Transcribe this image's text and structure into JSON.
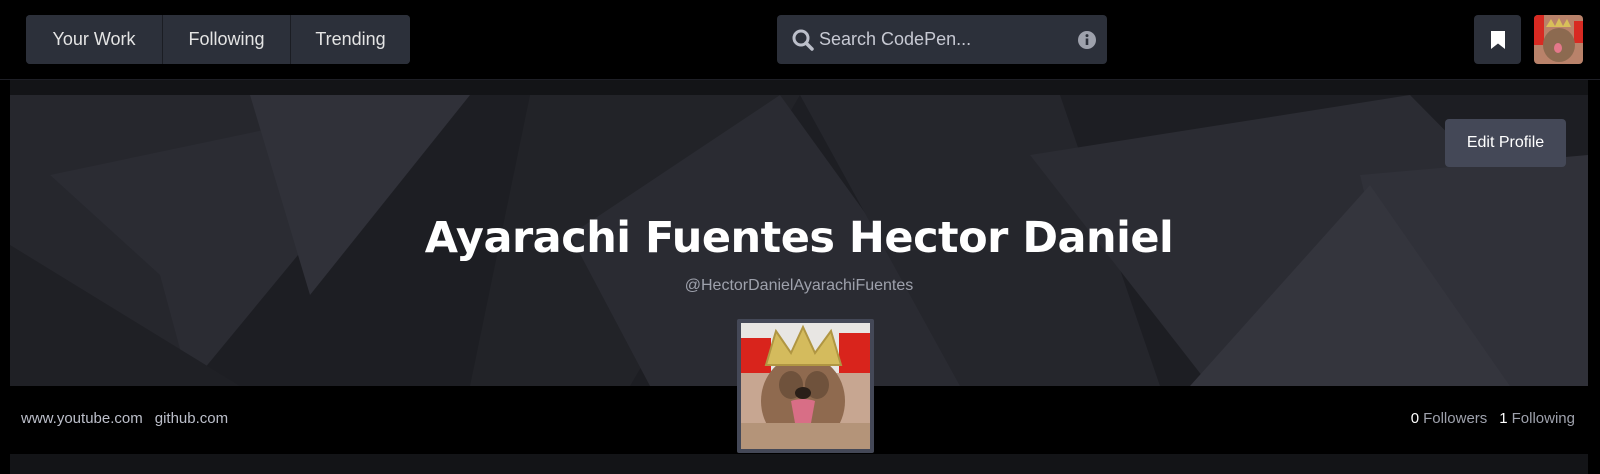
{
  "header": {
    "nav": [
      {
        "label": "Your Work"
      },
      {
        "label": "Following"
      },
      {
        "label": "Trending"
      }
    ],
    "search": {
      "placeholder": "Search CodePen..."
    }
  },
  "profile": {
    "edit_label": "Edit Profile",
    "name": "Ayarachi Fuentes Hector Daniel",
    "handle": "@HectorDanielAyarachiFuentes",
    "links": [
      "www.youtube.com",
      "github.com"
    ],
    "followers_count": "0",
    "followers_label": "Followers",
    "following_count": "1",
    "following_label": "Following"
  },
  "colors": {
    "accent": "#444857",
    "header_bg": "#000000",
    "hero_bg": "#1c1d22"
  },
  "icons": {
    "search": "search-icon",
    "info": "info-icon",
    "bookmark": "bookmark-icon"
  }
}
